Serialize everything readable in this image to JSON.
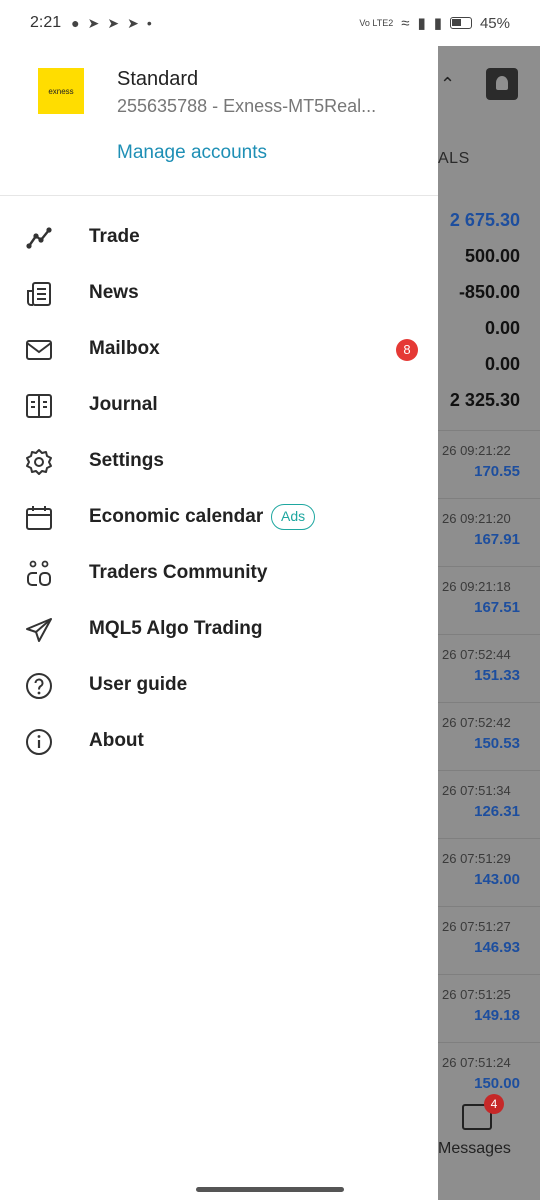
{
  "status_bar": {
    "time": "2:21",
    "indicators": "Vo LTE2",
    "battery": "45%"
  },
  "account": {
    "logo_text": "exness",
    "type": "Standard",
    "number": "255635788 - Exness-MT5Real...",
    "manage_label": "Manage accounts"
  },
  "menu": {
    "items": [
      {
        "label": "Trade",
        "icon": "trade-icon"
      },
      {
        "label": "News",
        "icon": "news-icon"
      },
      {
        "label": "Mailbox",
        "icon": "mailbox-icon",
        "badge": "8"
      },
      {
        "label": "Journal",
        "icon": "journal-icon"
      },
      {
        "label": "Settings",
        "icon": "gear-icon"
      },
      {
        "label": "Economic calendar",
        "icon": "calendar-icon",
        "tag": "Ads"
      },
      {
        "label": "Traders Community",
        "icon": "community-icon"
      },
      {
        "label": "MQL5 Algo Trading",
        "icon": "send-icon"
      },
      {
        "label": "User guide",
        "icon": "help-icon"
      },
      {
        "label": "About",
        "icon": "info-icon"
      }
    ]
  },
  "background": {
    "tab_partial": "ALS",
    "balances": [
      "2 675.30",
      "500.00",
      "-850.00",
      "0.00",
      "0.00",
      "2 325.30"
    ],
    "deals": [
      {
        "time": "26 09:21:22",
        "amount": "170.55"
      },
      {
        "time": "26 09:21:20",
        "amount": "167.91"
      },
      {
        "time": "26 09:21:18",
        "amount": "167.51"
      },
      {
        "time": "26 07:52:44",
        "amount": "151.33"
      },
      {
        "time": "26 07:52:42",
        "amount": "150.53"
      },
      {
        "time": "26 07:51:34",
        "amount": "126.31"
      },
      {
        "time": "26 07:51:29",
        "amount": "143.00"
      },
      {
        "time": "26 07:51:27",
        "amount": "146.93"
      },
      {
        "time": "26 07:51:25",
        "amount": "149.18"
      },
      {
        "time": "26 07:51:24",
        "amount": "150.00"
      }
    ],
    "messages_label": "Messages",
    "messages_badge": "4"
  },
  "colors": {
    "accent": "#1e8fb5",
    "badge": "#e53935",
    "ads": "#1ea7a0",
    "logo": "#ffdd00",
    "amount": "#1d4e9e"
  }
}
